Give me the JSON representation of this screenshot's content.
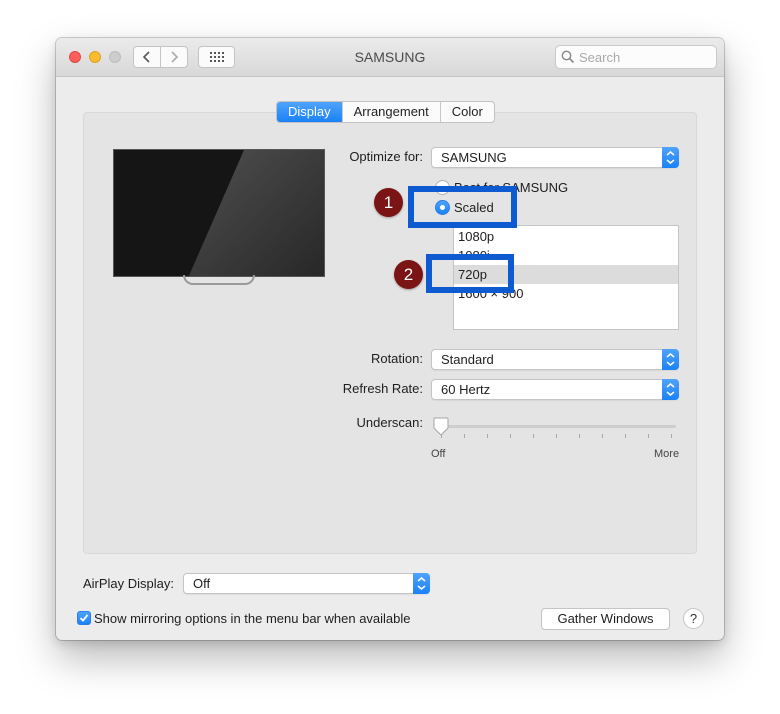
{
  "window": {
    "title": "SAMSUNG",
    "search_placeholder": "Search"
  },
  "tabs": [
    {
      "label": "Display",
      "active": true
    },
    {
      "label": "Arrangement",
      "active": false
    },
    {
      "label": "Color",
      "active": false
    }
  ],
  "optimize": {
    "label": "Optimize for:",
    "value": "SAMSUNG"
  },
  "resolution": {
    "default_option": "Best for SAMSUNG",
    "scaled_option": "Scaled",
    "selected_option": "Scaled",
    "list": [
      "1080p",
      "1080i",
      "720p",
      "1600 × 900"
    ],
    "selected_item": "720p"
  },
  "rotation": {
    "label": "Rotation:",
    "value": "Standard"
  },
  "refresh": {
    "label": "Refresh Rate:",
    "value": "60 Hertz"
  },
  "underscan": {
    "label": "Underscan:",
    "min_label": "Off",
    "max_label": "More",
    "value": 0
  },
  "airplay": {
    "label": "AirPlay Display:",
    "value": "Off"
  },
  "mirroring": {
    "label": "Show mirroring options in the menu bar when available",
    "checked": true
  },
  "gather_button": "Gather Windows",
  "help_button": "?",
  "annotations": [
    {
      "number": "1",
      "target": "Scaled"
    },
    {
      "number": "2",
      "target": "720p"
    }
  ],
  "colors": {
    "accent": "#1a82f7",
    "annotation_box": "#0e5bd1",
    "annotation_badge": "#7b1414"
  }
}
